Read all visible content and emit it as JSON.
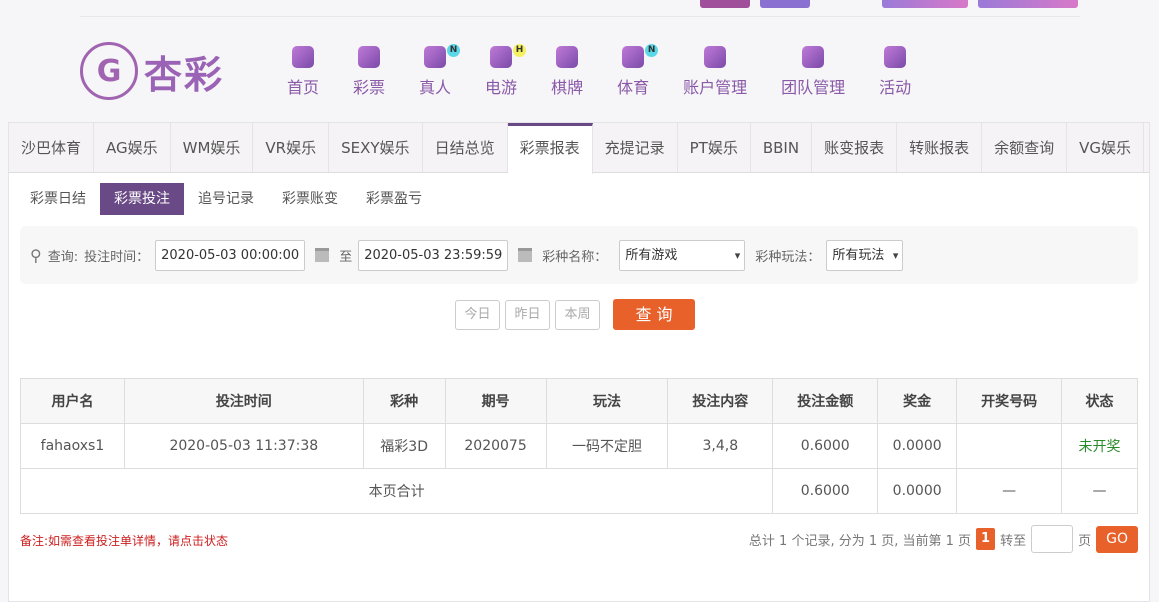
{
  "brand": {
    "logo_text": "杏彩",
    "colors": {
      "accent": "#6a4a86",
      "orange": "#e8602a",
      "green": "#2a8a2a",
      "red": "#cc1f1f"
    }
  },
  "nav": [
    {
      "label": "首页",
      "icon": "home-icon"
    },
    {
      "label": "彩票",
      "icon": "ticket-icon"
    },
    {
      "label": "真人",
      "icon": "live-dealer-icon",
      "badge": "N"
    },
    {
      "label": "电游",
      "icon": "gamepad-icon",
      "badge": "H"
    },
    {
      "label": "棋牌",
      "icon": "cards-icon"
    },
    {
      "label": "体育",
      "icon": "trophy-icon",
      "badge": "N"
    },
    {
      "label": "账户管理",
      "icon": "yen-icon"
    },
    {
      "label": "团队管理",
      "icon": "team-icon"
    },
    {
      "label": "活动",
      "icon": "gift-icon"
    }
  ],
  "tabs": [
    "沙巴体育",
    "AG娱乐",
    "WM娱乐",
    "VR娱乐",
    "SEXY娱乐",
    "日结总览",
    "彩票报表",
    "充提记录",
    "PT娱乐",
    "BBIN",
    "账变报表",
    "转账报表",
    "余额查询",
    "VG娱乐"
  ],
  "subtabs": [
    "彩票日结",
    "彩票投注",
    "追号记录",
    "彩票账变",
    "彩票盈亏"
  ],
  "filter": {
    "query_label": "查询:",
    "time_label": "投注时间：",
    "start": "2020-05-03 00:00:00",
    "to": "至",
    "end": "2020-05-03 23:59:59",
    "game_label": "彩种名称：",
    "game_value": "所有游戏",
    "play_label": "彩种玩法：",
    "play_value": "所有玩法"
  },
  "buttons": {
    "today": "今日",
    "yesterday": "昨日",
    "week": "本周",
    "search": "查 询"
  },
  "table": {
    "headers": [
      "用户名",
      "投注时间",
      "彩种",
      "期号",
      "玩法",
      "投注内容",
      "投注金额",
      "奖金",
      "开奖号码",
      "状态"
    ],
    "rows": [
      [
        "fahaoxs1",
        "2020-05-03 11:37:38",
        "福彩3D",
        "2020075",
        "一码不定胆",
        "3,4,8",
        "0.6000",
        "0.0000",
        "",
        "未开奖"
      ]
    ],
    "total": {
      "label": "本页合计",
      "amount": "0.6000",
      "bonus": "0.0000",
      "code": "—",
      "status": "—"
    }
  },
  "note": "备注:如需查看投注单详情，请点击状态",
  "pager": {
    "summary": "总计 1 个记录, 分为 1 页, 当前第 1 页",
    "current": "1",
    "goto": "转至",
    "page": "页",
    "go": "GO"
  }
}
